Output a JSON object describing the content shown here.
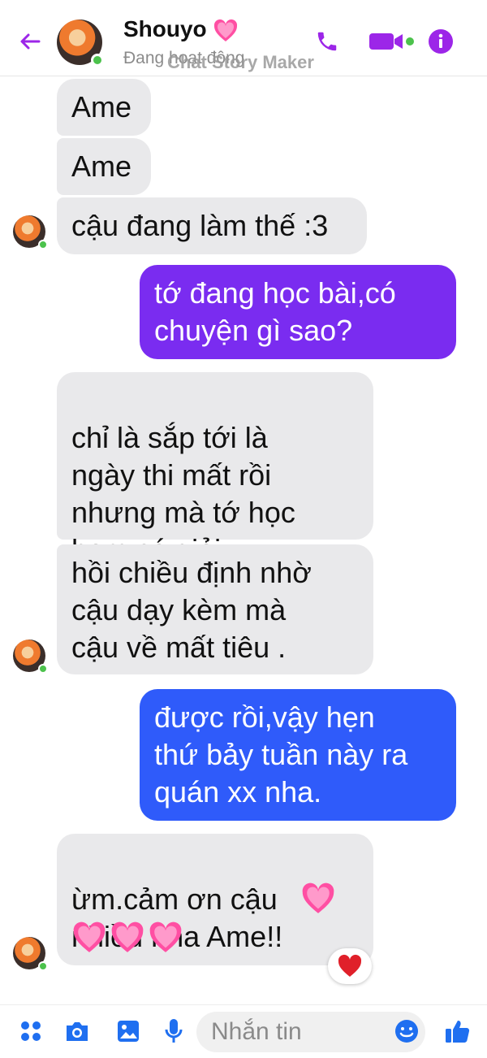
{
  "header": {
    "contact_name": "Shouyo",
    "status": "Đang hoạt động",
    "watermark": "Chat Story Maker",
    "icons": [
      "back-arrow-icon",
      "phone-icon",
      "video-camera-icon",
      "info-icon"
    ],
    "accent_color": "#9c26e8"
  },
  "messages": [
    {
      "side": "in",
      "text": "Ame"
    },
    {
      "side": "in",
      "text": "Ame"
    },
    {
      "side": "in",
      "text": "cậu đang làm thế :3"
    },
    {
      "side": "out",
      "text": "tớ đang học bài,có\nchuyện gì sao?"
    },
    {
      "side": "in",
      "text": "chỉ là sắp tới là\nngày thi mất rồi\nnhưng mà tớ học\nhem có giỏi"
    },
    {
      "side": "in",
      "text": "hồi chiều định nhờ\ncậu dạy kèm mà\ncậu về mất tiêu ."
    },
    {
      "side": "out",
      "text": "được rồi,vậy hẹn\nthứ bảy tuần này ra\nquán xx nha."
    },
    {
      "side": "in",
      "text": "ừm.cảm ơn cậu\nnhiều nha Ame!!"
    }
  ],
  "bubble_colors": {
    "incoming": "#e9e9eb",
    "outgoing_1": "#7a2cf0",
    "outgoing_2": "#2f5bfa"
  },
  "reaction": "heart",
  "composer": {
    "placeholder": "Nhắn tin",
    "icons": [
      "apps-icon",
      "camera-icon",
      "gallery-icon",
      "microphone-icon",
      "emoji-icon",
      "like-icon"
    ]
  }
}
